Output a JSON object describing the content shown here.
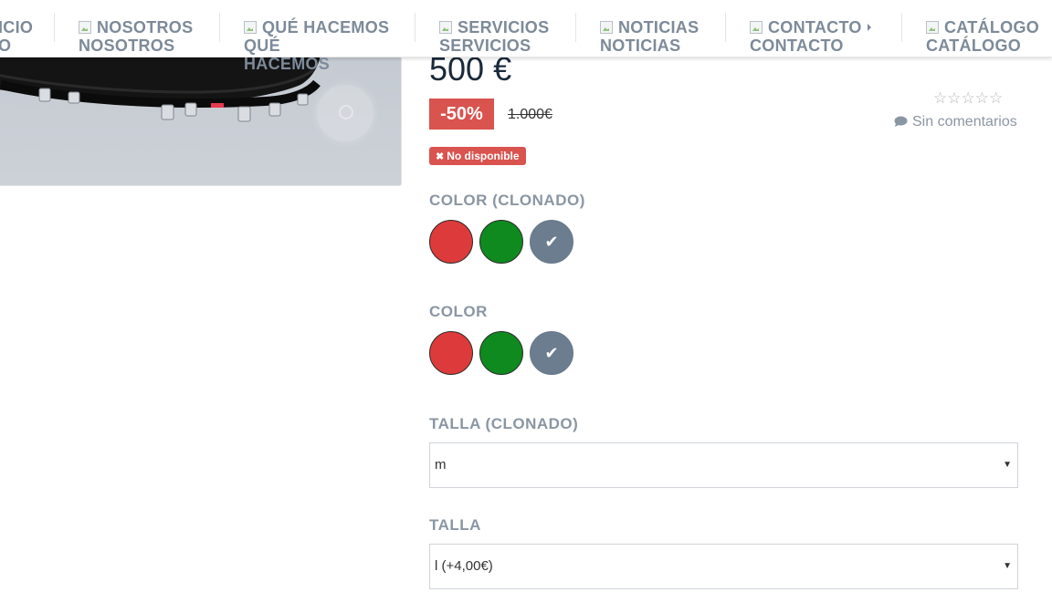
{
  "nav": {
    "items": [
      {
        "line1": "ICIO",
        "line2": "O"
      },
      {
        "line1": "NOSOTROS",
        "line2": "NOSOTROS"
      },
      {
        "line1": "QUÉ HACEMOS",
        "line2": "QUÉ",
        "line3": "HACEMOS"
      },
      {
        "line1": "SERVICIOS",
        "line2": "SERVICIOS"
      },
      {
        "line1": "NOTICIAS",
        "line2": "NOTICIAS"
      },
      {
        "line1": "CONTACTO",
        "line2": "CONTACTO"
      },
      {
        "line1": "CATÁLOGO",
        "line2": "CATÁLOGO"
      }
    ]
  },
  "product": {
    "price": "500 €",
    "discount": "-50%",
    "old_price": "1.000€",
    "rating_stars": "☆☆☆☆☆",
    "reviews_label": "Sin comentarios",
    "availability": "No disponible",
    "availability_icon": "✖"
  },
  "attributes": {
    "color_cloned": {
      "label": "COLOR (CLONADO)",
      "swatches": [
        "#dd3b3b",
        "#0f8a1f",
        "#6b7d8f"
      ],
      "selected_index": 2
    },
    "color": {
      "label": "COLOR",
      "swatches": [
        "#dd3b3b",
        "#0f8a1f",
        "#6b7d8f"
      ],
      "selected_index": 2
    },
    "size_cloned": {
      "label": "TALLA (CLONADO)",
      "value": "m",
      "arrow": "▼"
    },
    "size": {
      "label": "TALLA",
      "value": "l (+4,00€)",
      "arrow": "▼"
    }
  },
  "icons": {
    "check": "✔",
    "comment": "comment-icon",
    "zoom": "zoom-lens-icon"
  }
}
